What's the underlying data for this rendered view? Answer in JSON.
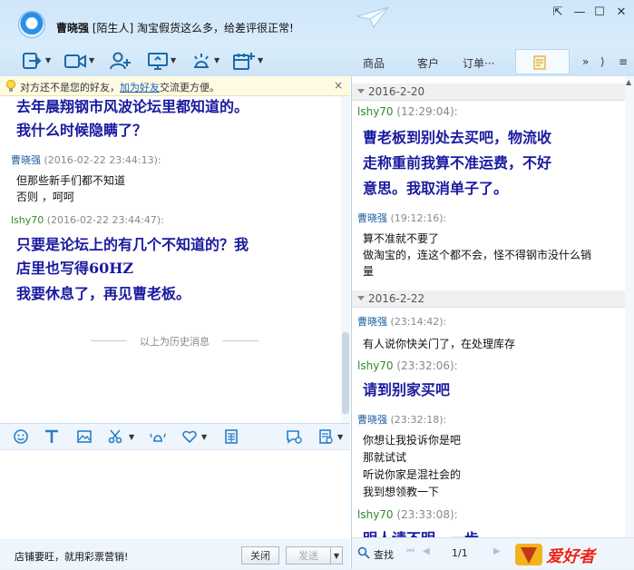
{
  "titlebar": {
    "contact_name": "曹晓强",
    "contact_tag": "[陌生人]",
    "contact_sign": "淘宝假货这么多，给差评很正常!"
  },
  "tabs": [
    "商品",
    "客户",
    "订单···"
  ],
  "notice": {
    "prefix": "对方还不是您的好友，",
    "link": "加为好友",
    "suffix": "交流更方便。",
    "close": "×"
  },
  "left_chat": {
    "lines": [
      {
        "type": "big",
        "text": "去年晨翔钢市风波论坛里都知道的。"
      },
      {
        "type": "big",
        "text": "我什么时候隐瞒了？"
      },
      {
        "type": "meta",
        "sender": "曹晓强",
        "time": "(2016-02-22 23:44:13):"
      },
      {
        "type": "small",
        "text": "但那些新手们都不知道"
      },
      {
        "type": "small",
        "text": "否则 ，呵呵"
      },
      {
        "type": "meta2",
        "sender": "lshy70",
        "time": "(2016-02-22 23:44:47):"
      },
      {
        "type": "big",
        "text": "只要是论坛上的有几个不知道的？我"
      },
      {
        "type": "big",
        "text": "店里也写得60HZ"
      },
      {
        "type": "big",
        "text": "我要休息了，再见曹老板。"
      }
    ],
    "history_label": "以上为历史消息"
  },
  "bottom": {
    "promo": "店铺要旺，就用彩票营销!",
    "close_btn": "关闭",
    "send_btn": "发送"
  },
  "right_chat": {
    "date1": "2016-2-20",
    "m1_sender": "lshy70",
    "m1_time": "(12:29:04):",
    "m1_l1": "曹老板到别处去买吧，物流收",
    "m1_l2": "走称重前我算不准运费，不好",
    "m1_l3": "意思。我取消单子了。",
    "m2_sender": "曹晓强",
    "m2_time": "(19:12:16):",
    "m2_l1": "算不准就不要了",
    "m2_l2": "做淘宝的，连这个都不会，怪不得钢市没什么销",
    "m2_l3": "量",
    "date2": "2016-2-22",
    "m3_sender": "曹晓强",
    "m3_time": "(23:14:42):",
    "m3_l1": "有人说你快关门了，在处理库存",
    "m4_sender": "lshy70",
    "m4_time": "(23:32:06):",
    "m4_l1": "请到别家买吧",
    "m5_sender": "曹晓强",
    "m5_time": "(23:32:18):",
    "m5_l1": "你想让我投诉你是吧",
    "m5_l2": "那就试试",
    "m5_l3": "听说你家是混社会的",
    "m5_l4": "我到想领教一下",
    "m6_sender": "lshy70",
    "m6_time": "(23:33:08):",
    "m6_l1": "明人请不明，一步"
  },
  "right_bottom": {
    "search": "查找",
    "page": "1/1",
    "logo_text": "爱好者"
  }
}
